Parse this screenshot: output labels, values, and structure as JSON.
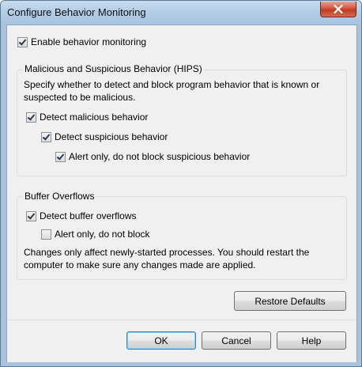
{
  "window": {
    "title": "Configure Behavior Monitoring"
  },
  "enable": {
    "label": "Enable behavior monitoring",
    "checked": true
  },
  "hips": {
    "title": "Malicious and Suspicious Behavior (HIPS)",
    "description_line1": "Specify whether to detect and block program behavior that is known or",
    "description_line2": "suspected to be malicious.",
    "detect_malicious": {
      "label": "Detect malicious behavior",
      "checked": true
    },
    "detect_suspicious": {
      "label": "Detect suspicious behavior",
      "checked": true
    },
    "alert_only": {
      "label": "Alert only, do not block suspicious behavior",
      "checked": true
    }
  },
  "buffer": {
    "title": "Buffer Overflows",
    "detect": {
      "label": "Detect buffer overflows",
      "checked": true
    },
    "alert_only": {
      "label": "Alert only, do not block",
      "checked": false
    },
    "note_line1": "Changes only affect newly-started processes. You should restart the",
    "note_line2": "computer to make sure any changes made are applied."
  },
  "buttons": {
    "restore": "Restore Defaults",
    "ok": "OK",
    "cancel": "Cancel",
    "help": "Help"
  },
  "icons": {
    "close": "close-icon",
    "checkmark": "checkmark-icon"
  }
}
